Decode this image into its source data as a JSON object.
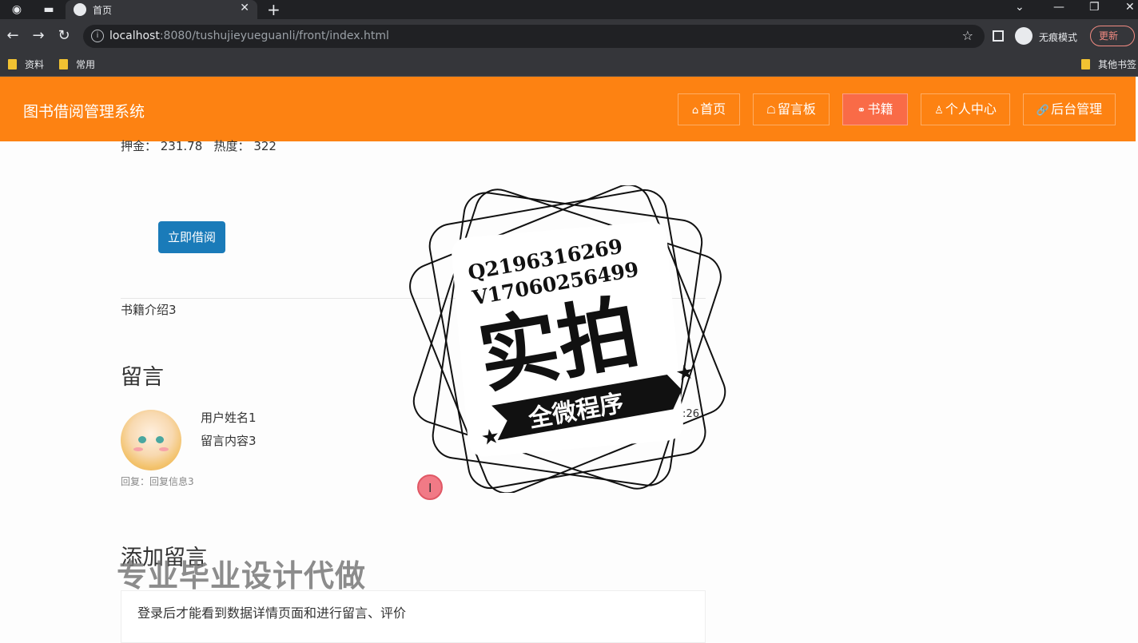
{
  "browser": {
    "tab_title": "首页",
    "url_host": "localhost",
    "url_path": ":8080/tushujieyueguanli/front/index.html",
    "incognito_label": "无痕模式",
    "update_label": "更新",
    "bookmarks": [
      "资料",
      "常用"
    ],
    "other_bookmarks": "其他书签"
  },
  "site": {
    "title": "图书借阅管理系统",
    "nav": [
      {
        "icon": "⌂",
        "label": "首页"
      },
      {
        "icon": "☖",
        "label": "留言板"
      },
      {
        "icon": "⚭",
        "label": "书籍"
      },
      {
        "icon": "♙",
        "label": "个人中心"
      },
      {
        "icon": "🔗",
        "label": "后台管理"
      }
    ]
  },
  "book": {
    "stats": "押金： 231.78   热度： 322",
    "borrow_button": "立即借阅",
    "intro": "书籍介绍3"
  },
  "comments": {
    "heading": "留言",
    "items": [
      {
        "user": "用户姓名1",
        "content": "留言内容3",
        "time": "-07-29 10:57:26",
        "reply": "回复：回复信息3"
      }
    ]
  },
  "add_comment": {
    "heading": "添加留言",
    "login_notice": "登录后才能看到数据详情页面和进行留言、评价"
  },
  "watermark": {
    "qq": "Q2196316269",
    "wechat": "V17060256499",
    "big": "实拍",
    "ribbon": "全微程序",
    "overlay": "专业毕业设计代做"
  },
  "colors": {
    "header": "#fd8212",
    "nav_active": "#f96b47",
    "primary_button": "#1a7bb9"
  }
}
